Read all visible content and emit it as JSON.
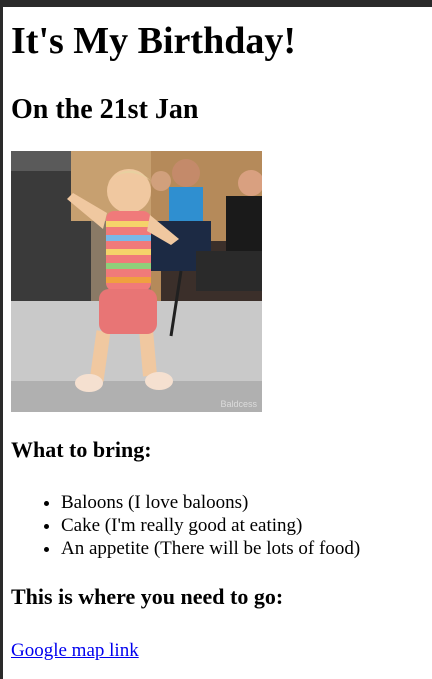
{
  "page": {
    "title": "It's My Birthday!",
    "subtitle": "On the 21st Jan",
    "image_watermark": "Baldcess",
    "bring_heading": "What to bring:",
    "bring_items": [
      "Baloons (I love baloons)",
      "Cake (I'm really good at eating)",
      "An appetite (There will be lots of food)"
    ],
    "go_heading": "This is where you need to go:",
    "map_link": "Google map link"
  }
}
